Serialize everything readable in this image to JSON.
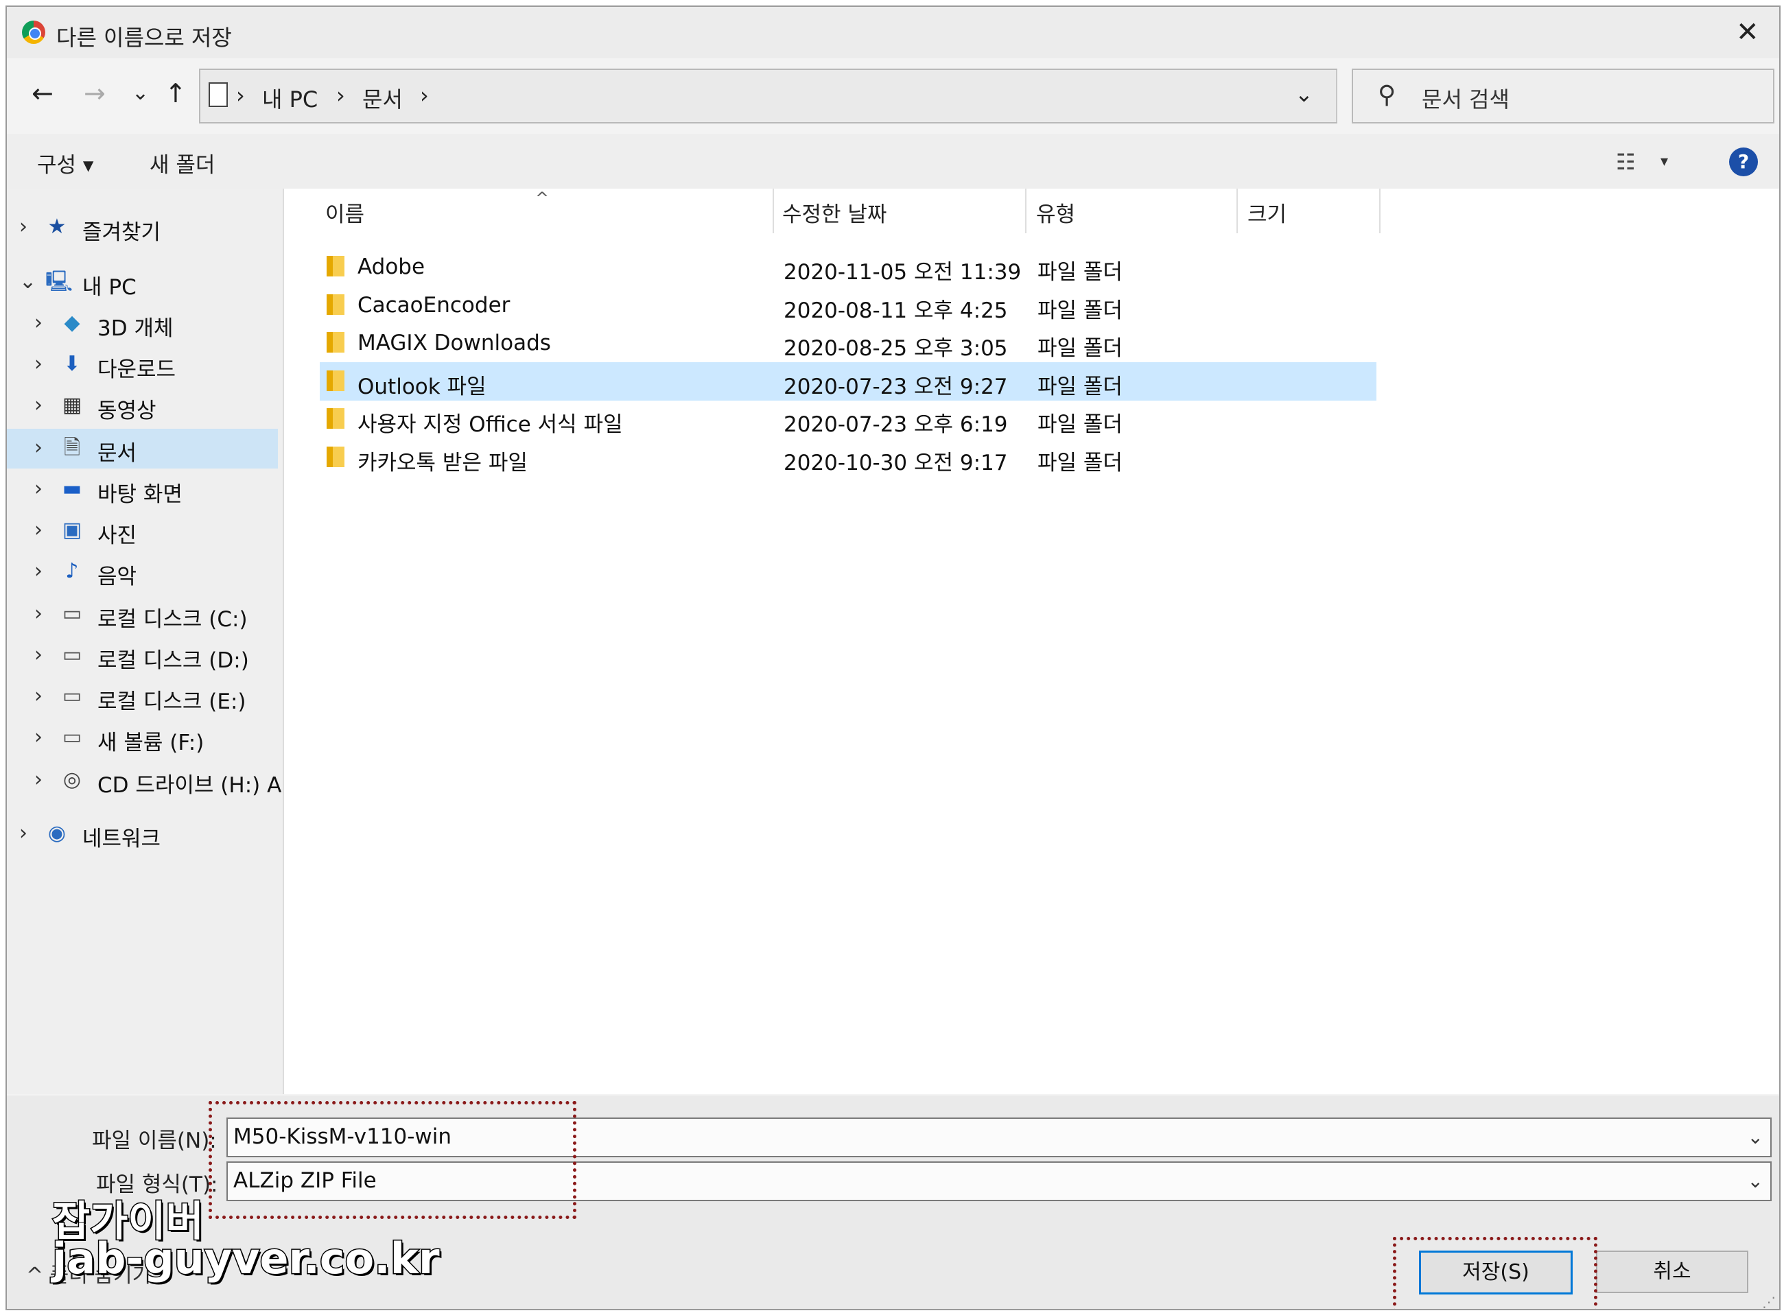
{
  "window": {
    "title": "다른 이름으로 저장",
    "close_symbol": "✕"
  },
  "address_bar": {
    "breadcrumbs": [
      "내 PC",
      "문서"
    ],
    "separator": "›",
    "back": "←",
    "forward": "→",
    "recent": "⌄",
    "up": "↑",
    "dropdown": "⌄",
    "refresh": "↻"
  },
  "search": {
    "placeholder": "문서 검색",
    "icon": "⚲"
  },
  "toolbar": {
    "organize": "구성 ▾",
    "new_folder": "새 폴더",
    "view_icon": "☷",
    "view_drop": "▾",
    "help": "?"
  },
  "nav": {
    "items": [
      {
        "label": "즐겨찾기",
        "icon": "★",
        "color": "#1a4fa0",
        "chevron": "›",
        "level": 0
      },
      {
        "label": "내 PC",
        "icon": "🖳",
        "color": "#2a6bc0",
        "chevron": "⌄",
        "level": 0
      },
      {
        "label": "3D 개체",
        "icon": "◆",
        "color": "#2a8ac8",
        "chevron": "›",
        "level": 1
      },
      {
        "label": "다운로드",
        "icon": "⬇",
        "color": "#1c5fbf",
        "chevron": "›",
        "level": 1
      },
      {
        "label": "동영상",
        "icon": "▦",
        "color": "#333333",
        "chevron": "›",
        "level": 1
      },
      {
        "label": "문서",
        "icon": "🗎",
        "color": "#444444",
        "chevron": "›",
        "level": 1
      },
      {
        "label": "바탕 화면",
        "icon": "▬",
        "color": "#1a5fc8",
        "chevron": "›",
        "level": 1
      },
      {
        "label": "사진",
        "icon": "▣",
        "color": "#2a6bc0",
        "chevron": "›",
        "level": 1
      },
      {
        "label": "음악",
        "icon": "♪",
        "color": "#1c5fbf",
        "chevron": "›",
        "level": 1
      },
      {
        "label": "로컬 디스크 (C:)",
        "icon": "▭",
        "color": "#555555",
        "chevron": "›",
        "level": 1
      },
      {
        "label": "로컬 디스크 (D:)",
        "icon": "▭",
        "color": "#555555",
        "chevron": "›",
        "level": 1
      },
      {
        "label": "로컬 디스크 (E:)",
        "icon": "▭",
        "color": "#555555",
        "chevron": "›",
        "level": 1
      },
      {
        "label": "새 볼륨 (F:)",
        "icon": "▭",
        "color": "#555555",
        "chevron": "›",
        "level": 1
      },
      {
        "label": "CD 드라이브 (H:) A",
        "icon": "◎",
        "color": "#444444",
        "chevron": "›",
        "level": 1
      },
      {
        "label": "네트워크",
        "icon": "◉",
        "color": "#2a6bc0",
        "chevron": "›",
        "level": 0
      }
    ],
    "selected": "문서"
  },
  "columns": {
    "name": "이름",
    "modified": "수정한 날짜",
    "type": "유형",
    "size": "크기",
    "sort_caret": "^"
  },
  "files": [
    {
      "name": "Adobe",
      "modified": "2020-11-05 오전 11:39",
      "type": "파일 폴더",
      "selected": false
    },
    {
      "name": "CacaoEncoder",
      "modified": "2020-08-11 오후 4:25",
      "type": "파일 폴더",
      "selected": false
    },
    {
      "name": "MAGIX Downloads",
      "modified": "2020-08-25 오후 3:05",
      "type": "파일 폴더",
      "selected": false
    },
    {
      "name": "Outlook 파일",
      "modified": "2020-07-23 오전 9:27",
      "type": "파일 폴더",
      "selected": true
    },
    {
      "name": "사용자 지정 Office 서식 파일",
      "modified": "2020-07-23 오후 6:19",
      "type": "파일 폴더",
      "selected": false
    },
    {
      "name": "카카오톡 받은 파일",
      "modified": "2020-10-30 오전 9:17",
      "type": "파일 폴더",
      "selected": false
    }
  ],
  "save_form": {
    "filename_label": "파일 이름(N):",
    "filename_value": "M50-KissM-v110-win",
    "filetype_label": "파일 형식(T):",
    "filetype_value": "ALZip ZIP File",
    "dropdown": "⌄",
    "hide_folders": "^ 폴더 숨기기",
    "save": "저장(S)",
    "cancel": "취소"
  },
  "watermark": {
    "line1": "잡가이버",
    "line2": "jab-guyver.co.kr"
  },
  "colors": {
    "selection": "#cce8ff",
    "nav_selection": "#cde4f6",
    "folder": "#f8cd4f",
    "highlight_box": "#8a1a1a",
    "accent": "#0078d7"
  }
}
